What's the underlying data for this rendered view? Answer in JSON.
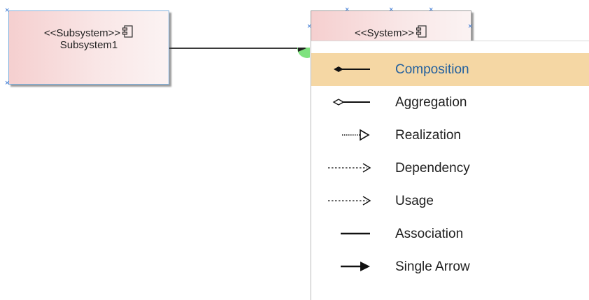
{
  "diagram": {
    "subsystem_node": {
      "stereotype": "<<Subsystem>>",
      "name": "Subsystem1"
    },
    "system_node": {
      "stereotype": "<<System>>"
    }
  },
  "menu": {
    "items": [
      {
        "label": "Composition",
        "icon": "composition-icon",
        "selected": true
      },
      {
        "label": "Aggregation",
        "icon": "aggregation-icon"
      },
      {
        "label": "Realization",
        "icon": "realization-icon"
      },
      {
        "label": "Dependency",
        "icon": "dependency-icon"
      },
      {
        "label": "Usage",
        "icon": "usage-icon"
      },
      {
        "label": "Association",
        "icon": "association-icon"
      },
      {
        "label": "Single Arrow",
        "icon": "single-arrow-icon"
      }
    ]
  },
  "colors": {
    "selection": "#f5d7a4",
    "selected_text": "#23609e",
    "node_fill": "#f5cfcf",
    "handle": "#2d6fd0",
    "anchor": "#7ee27e"
  }
}
